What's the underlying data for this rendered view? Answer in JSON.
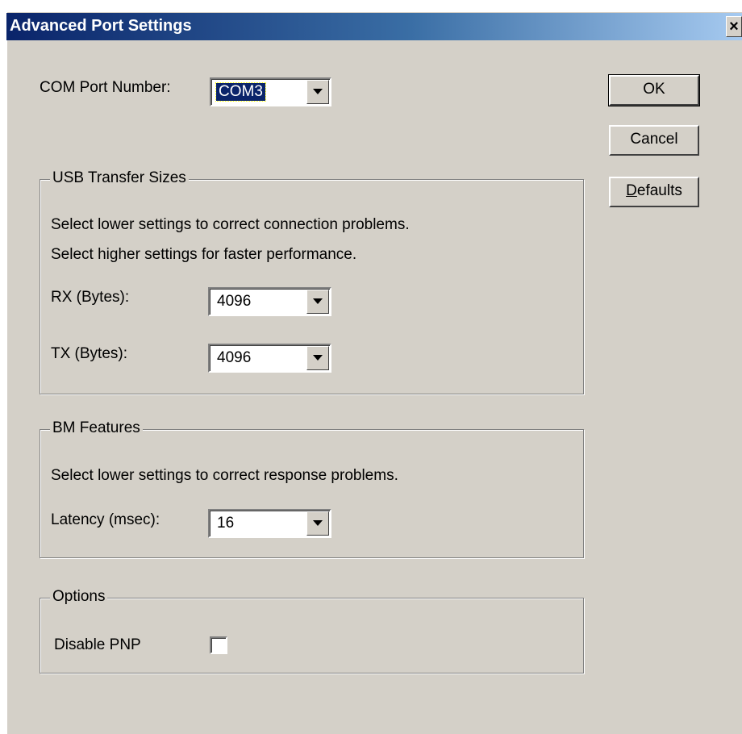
{
  "window": {
    "title": "Advanced Port Settings",
    "close_label": "×"
  },
  "com_port": {
    "label": "COM Port Number:",
    "value": "COM3"
  },
  "buttons": {
    "ok": "OK",
    "cancel": "Cancel",
    "defaults_mnemonic": "D",
    "defaults_rest": "efaults"
  },
  "usb_transfer": {
    "caption": "USB Transfer Sizes",
    "hint_lower": "Select lower settings to correct connection problems.",
    "hint_higher": "Select higher settings for faster performance.",
    "rx_label": "RX (Bytes):",
    "rx_value": "4096",
    "tx_label": "TX (Bytes):",
    "tx_value": "4096"
  },
  "bm_features": {
    "caption": "BM Features",
    "hint": "Select lower settings to correct response problems.",
    "latency_label": "Latency (msec):",
    "latency_value": "16"
  },
  "options": {
    "caption": "Options",
    "disable_pnp_label": "Disable PNP",
    "disable_pnp_checked": false
  },
  "colors": {
    "face": "#d4d0c8",
    "title_start": "#0a246a",
    "title_end": "#a6caf0"
  }
}
